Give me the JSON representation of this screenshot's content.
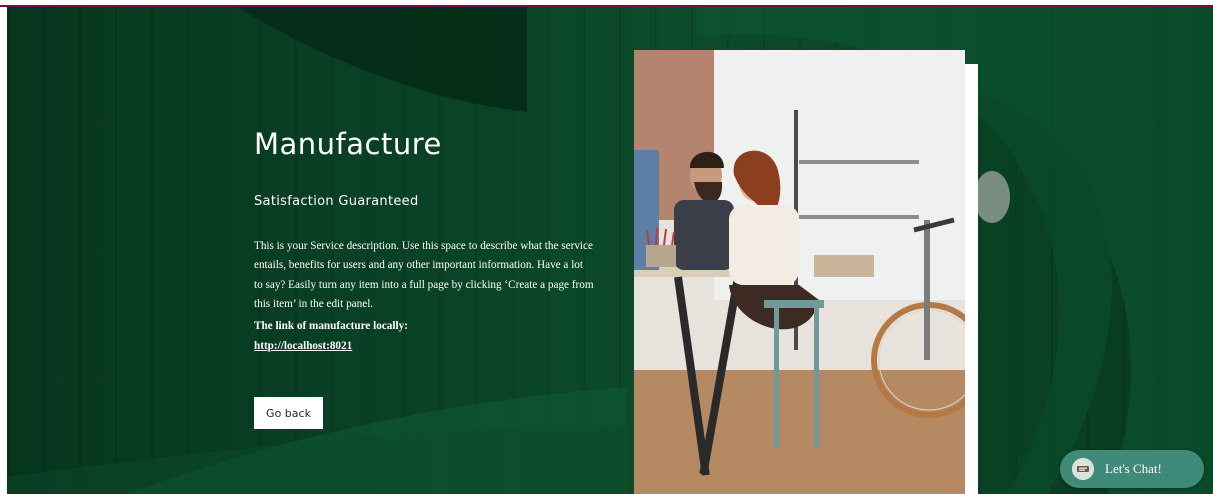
{
  "hero": {
    "title": "Manufacture",
    "subtitle": "Satisfaction Guaranteed",
    "description": "This is your Service description. Use this space to describe what the service entails, benefits for users and any other important information. Have a lot to say? Easily turn any item into a full page by clicking ‘Create a page from this item’ in the edit panel.",
    "link_heading": "The link of manufacture locally:",
    "link_url": "http://localhost:8021",
    "back_button_label": "Go back"
  },
  "chat": {
    "label": "Let's Chat!",
    "icon": "chat-avatar-icon"
  },
  "colors": {
    "background_green": "#0b4528",
    "accent_top": "#6a1240",
    "chat_button": "#3f8a78"
  }
}
